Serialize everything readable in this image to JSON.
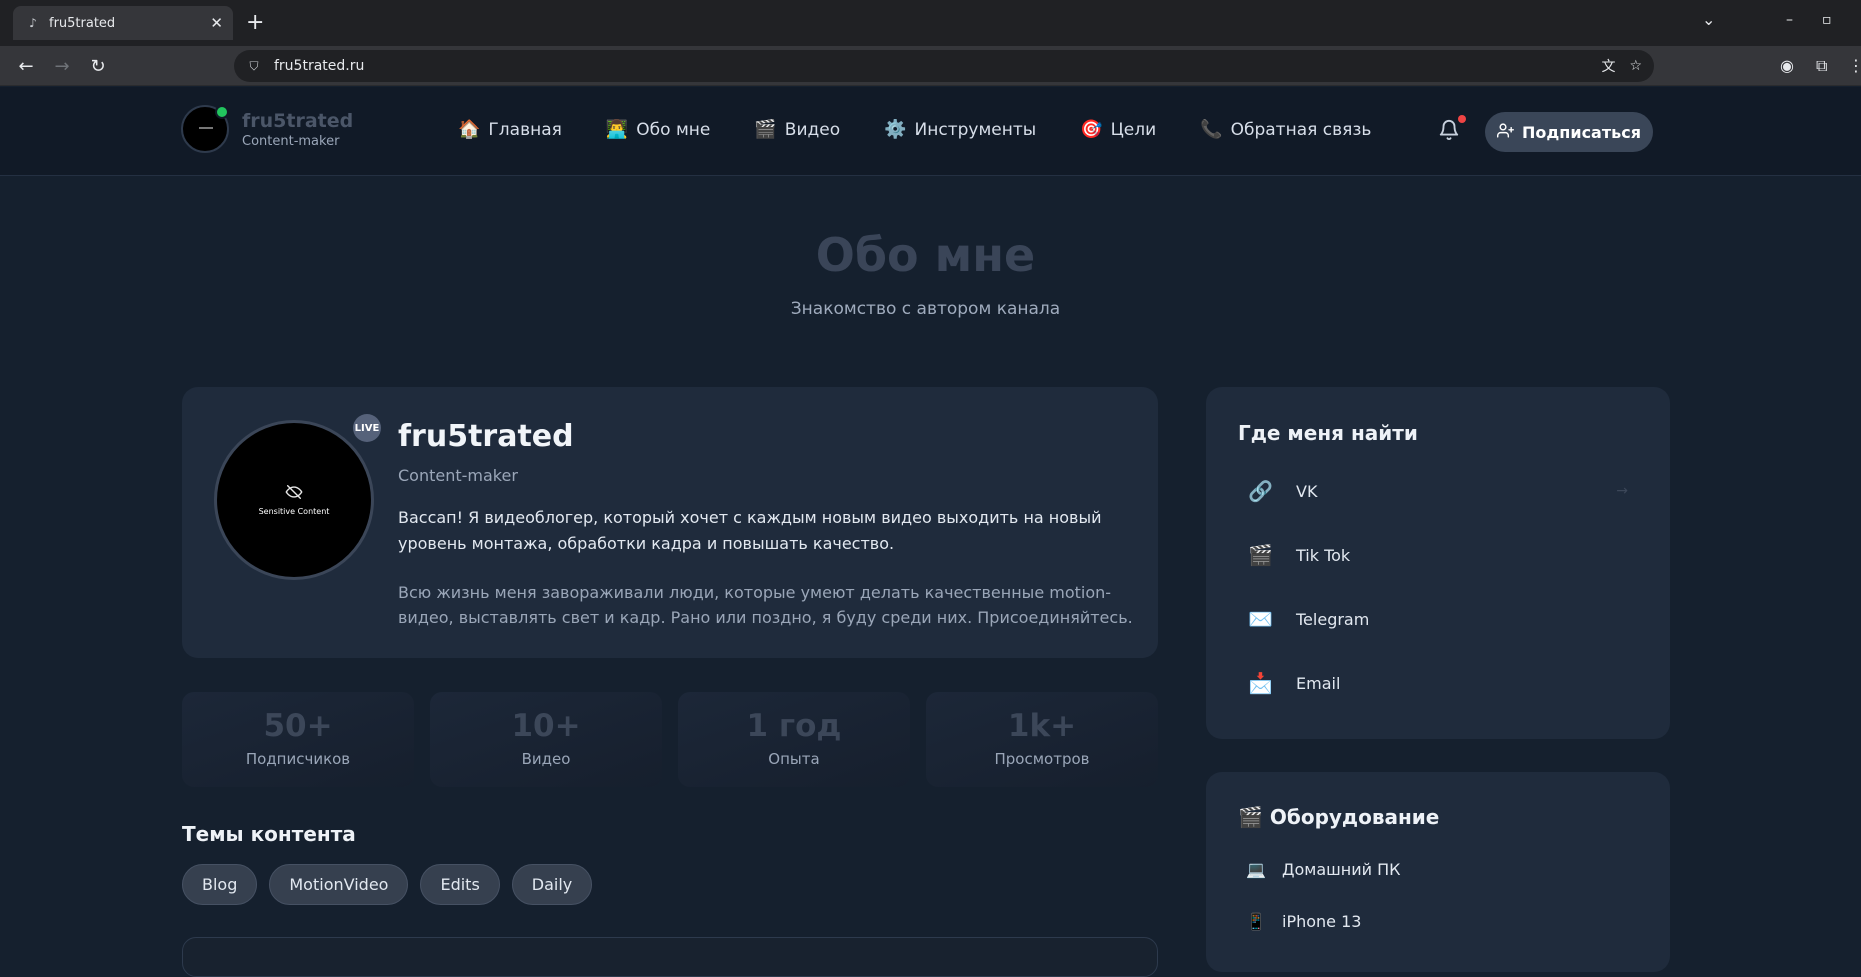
{
  "browser": {
    "tab_title": "fru5trated",
    "url": "fru5trated.ru",
    "new_tab": "+",
    "close": "✕"
  },
  "header": {
    "logo_name": "fru5trated",
    "logo_sub": "Content-maker",
    "nav": [
      {
        "icon": "🏠",
        "label": "Главная"
      },
      {
        "icon": "👨‍💻",
        "label": "Обо мне"
      },
      {
        "icon": "🎬",
        "label": "Видео"
      },
      {
        "icon": "⚙️",
        "label": "Инструменты"
      },
      {
        "icon": "🎯",
        "label": "Цели"
      },
      {
        "icon": "📞",
        "label": "Обратная связь"
      }
    ],
    "subscribe_label": "Подписаться"
  },
  "hero": {
    "title": "Обо мне",
    "subtitle": "Знакомство с автором канала"
  },
  "profile": {
    "avatar_text": "Sensitive Content",
    "live": "LIVE",
    "name": "fru5trated",
    "role": "Content-maker",
    "bio1": "Ваccап! Я видеоблогер, который хочет с каждым новым видео выходить на новый уровень монтажа, обработки кадра и повышать качество.",
    "bio2": "Всю жизнь меня завораживали люди, которые умеют делать качественные motion-видео, выставлять свет и кадр. Рано или поздно, я буду среди них. Присоединяйтесь."
  },
  "stats": [
    {
      "value": "50+",
      "label": "Подписчиков"
    },
    {
      "value": "10+",
      "label": "Видео"
    },
    {
      "value": "1 год",
      "label": "Опыта"
    },
    {
      "value": "1k+",
      "label": "Просмотров"
    }
  ],
  "topics": {
    "title": "Темы контента",
    "items": [
      "Blog",
      "MotionVideo",
      "Edits",
      "Daily"
    ]
  },
  "find": {
    "title": "Где меня найти",
    "links": [
      {
        "icon": "🔗",
        "label": "VK",
        "arrow": "→"
      },
      {
        "icon": "🎬",
        "label": "Tik Tok",
        "arrow": ""
      },
      {
        "icon": "✉️",
        "label": "Telegram",
        "arrow": ""
      },
      {
        "icon": "📩",
        "label": "Email",
        "arrow": ""
      }
    ]
  },
  "equipment": {
    "title": "🎬 Оборудование",
    "items": [
      {
        "icon": "💻",
        "label": "Домашний ПК"
      },
      {
        "icon": "📱",
        "label": "iPhone 13"
      }
    ]
  },
  "colors": {
    "page_bg": "#15202e",
    "card_bg": "#1f2b3c",
    "online": "#22c55e",
    "notification": "#ef4444"
  }
}
